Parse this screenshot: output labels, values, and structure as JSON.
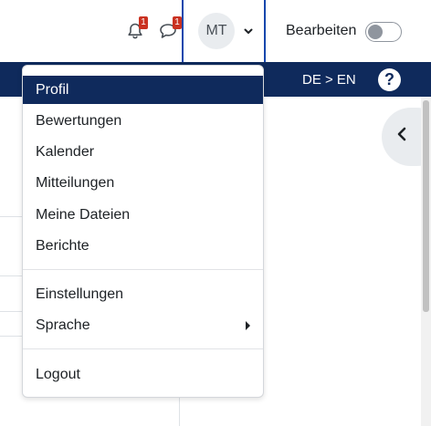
{
  "header": {
    "notifications": {
      "icon": "bell-icon",
      "count": "1"
    },
    "messages": {
      "icon": "chat-bubble-icon",
      "count": "1"
    },
    "user": {
      "initials": "MT",
      "caret_icon": "chevron-down-icon"
    },
    "edit_mode": {
      "label": "Bearbeiten",
      "enabled": false
    }
  },
  "navbar": {
    "language": "DE > EN",
    "help_icon": "question-icon",
    "help_glyph": "?"
  },
  "user_dropdown": {
    "groups": [
      [
        "Profil",
        "Bewertungen",
        "Kalender",
        "Mitteilungen",
        "Meine Dateien",
        "Berichte"
      ],
      [
        "Einstellungen",
        "Sprache"
      ],
      [
        "Logout"
      ]
    ],
    "active_item": "Profil",
    "items": {
      "profil": "Profil",
      "bewertungen": "Bewertungen",
      "kalender": "Kalender",
      "mitteilungen": "Mitteilungen",
      "meine_dateien": "Meine Dateien",
      "berichte": "Berichte",
      "einstellungen": "Einstellungen",
      "sprache": "Sprache",
      "logout": "Logout"
    }
  },
  "drawer": {
    "toggle_icon": "chevron-left-icon"
  },
  "colors": {
    "navbar_bg": "#0f2a5c",
    "active_item_bg": "#0f2a5c",
    "badge_bg": "#ca3120",
    "user_menu_border": "#0f47ad"
  }
}
